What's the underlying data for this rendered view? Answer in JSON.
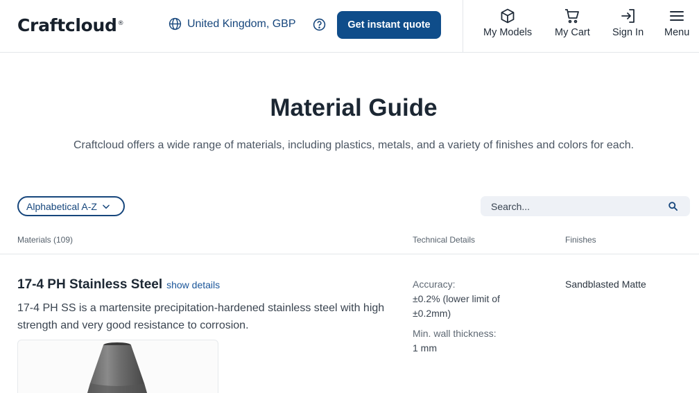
{
  "header": {
    "logo": "Craftcloud",
    "logo_mark": "®",
    "region": "United Kingdom, GBP",
    "quote_button": "Get instant quote",
    "nav": [
      {
        "label": "My Models",
        "icon": "cube-icon"
      },
      {
        "label": "My Cart",
        "icon": "cart-icon"
      },
      {
        "label": "Sign In",
        "icon": "sign-in-icon"
      },
      {
        "label": "Menu",
        "icon": "hamburger-icon"
      }
    ]
  },
  "hero": {
    "title": "Material Guide",
    "subtitle": "Craftcloud offers a wide range of materials, including plastics, metals, and a variety of finishes and colors for each."
  },
  "controls": {
    "sort_label": "Alphabetical A-Z",
    "search_placeholder": "Search..."
  },
  "table": {
    "headers": {
      "materials": "Materials (109)",
      "technical": "Technical Details",
      "finishes": "Finishes"
    },
    "rows": [
      {
        "name": "17-4 PH Stainless Steel",
        "details_link": "show details",
        "description": "17-4 PH SS is a martensite precipitation-hardened stainless steel with high strength and very good resistance to corrosion.",
        "accuracy_label": "Accuracy:",
        "accuracy_value": "±0.2% (lower limit of ±0.2mm)",
        "wall_label": "Min. wall thickness:",
        "wall_value": "1 mm",
        "finish": "Sandblasted Matte"
      }
    ]
  },
  "colors": {
    "primary": "#0f4d8a",
    "link": "#1a5599",
    "text": "#1c2733"
  }
}
